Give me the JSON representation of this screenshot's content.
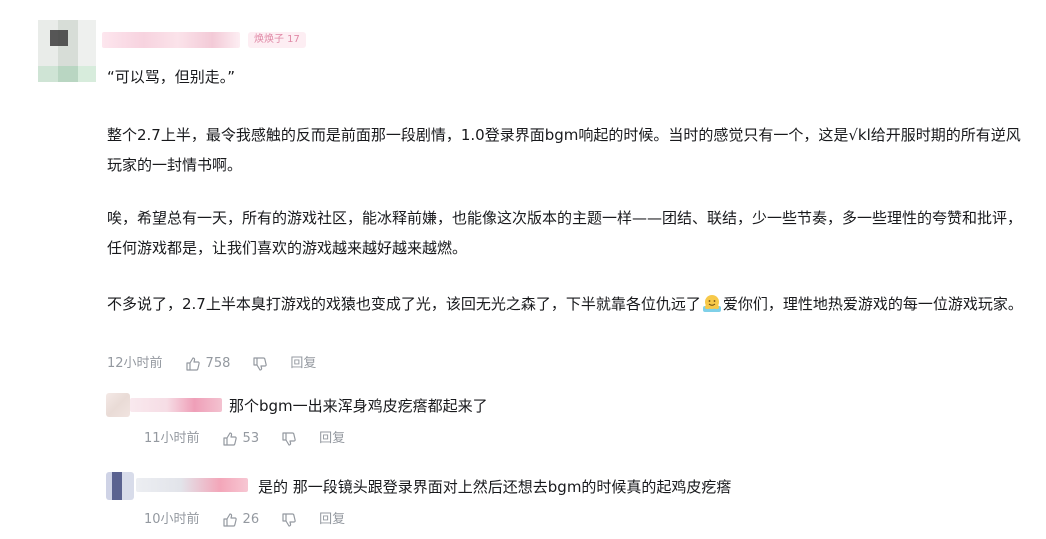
{
  "main_comment": {
    "level": "焕焕子 17",
    "paragraphs": [
      "“可以骂，但别走。”",
      "整个2.7上半，最令我感触的反而是前面那一段剧情，1.0登录界面bgm响起的时候。当时的感觉只有一个，这是√kl给开服时期的所有逆风玩家的一封情书啊。",
      "唉，希望总有一天，所有的游戏社区，能冰释前嫌，也能像这次版本的主题一样——团结、联结，少一些节奏，多一些理性的夸赞和批评，任何游戏都是，让我们喜欢的游戏越来越好越来越燃。"
    ],
    "last_para_before_emoji": "不多说了，2.7上半本臭打游戏的戏猿也变成了光，该回无光之森了，下半就靠各位仇远了",
    "last_para_after_emoji": "爱你们，理性地热爱游戏的每一位游戏玩家。",
    "emoji_name": "hug-emoji",
    "time": "12小时前",
    "likes": "758",
    "reply_label": "回复"
  },
  "replies": [
    {
      "text": "那个bgm一出来浑身鸡皮疙瘩都起来了",
      "time": "11小时前",
      "likes": "53",
      "reply_label": "回复"
    },
    {
      "text": "是的 那一段镜头跟登录界面对上然后还想去bgm的时候真的起鸡皮疙瘩",
      "time": "10小时前",
      "likes": "26",
      "reply_label": "回复"
    }
  ],
  "colors": {
    "text": "#18191c",
    "meta": "#9499a0",
    "level_badge": "#e08aa7"
  }
}
